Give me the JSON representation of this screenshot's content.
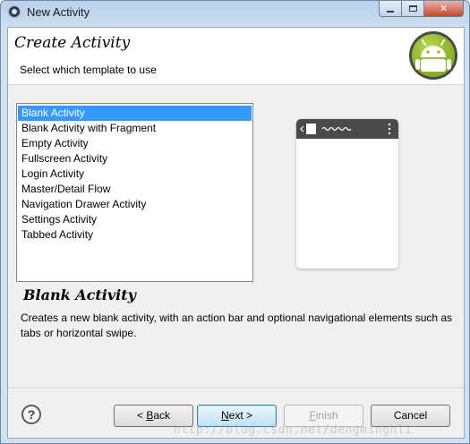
{
  "window": {
    "title": "New Activity",
    "buttons": {
      "close_glyph": "✕"
    }
  },
  "header": {
    "title": "Create Activity",
    "subtitle": "Select which template to use",
    "logo_icon": "android-icon"
  },
  "templates": {
    "items": [
      "Blank Activity",
      "Blank Activity with Fragment",
      "Empty Activity",
      "Fullscreen Activity",
      "Login Activity",
      "Master/Detail Flow",
      "Navigation Drawer Activity",
      "Settings Activity",
      "Tabbed Activity"
    ],
    "selected": "Blank Activity"
  },
  "description": {
    "title": "Blank Activity",
    "text": "Creates a new blank activity, with an action bar and optional navigational elements such as tabs or horizontal swipe."
  },
  "footer": {
    "help_icon": "?",
    "back_prefix": "< ",
    "back_mnemonic": "B",
    "back_rest": "ack",
    "next_mnemonic": "N",
    "next_rest": "ext >",
    "finish_mnemonic": "F",
    "finish_rest": "inish",
    "cancel_label": "Cancel"
  },
  "watermark": "http://blog.csdn.net/dengminghli",
  "colors": {
    "selection": "#3399ff",
    "android_green": "#97c024"
  }
}
